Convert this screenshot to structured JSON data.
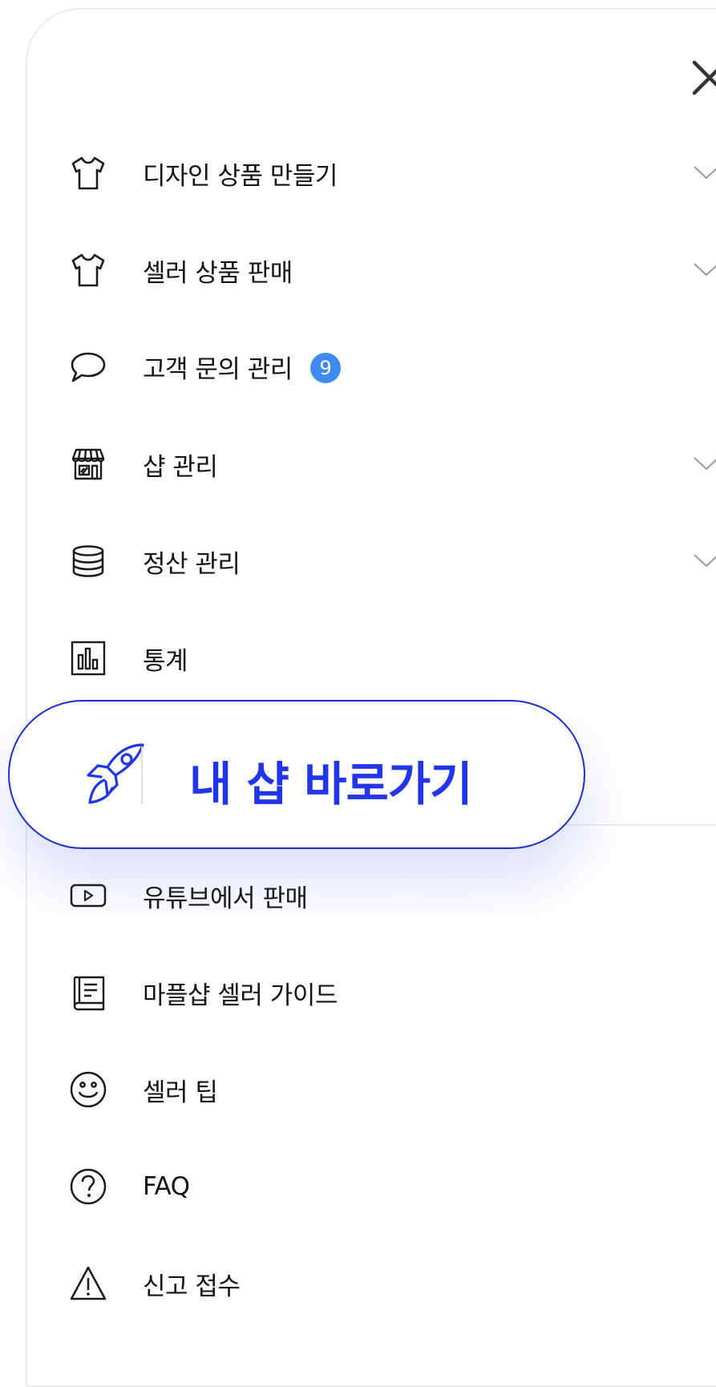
{
  "menu": {
    "primary": [
      {
        "label": "디자인 상품 만들기",
        "icon": "tshirt-icon",
        "expandable": true
      },
      {
        "label": "셀러 상품 판매",
        "icon": "tshirt-icon",
        "expandable": true
      },
      {
        "label": "고객 문의 관리",
        "icon": "chat-bubble-icon",
        "expandable": false,
        "badge": "9"
      },
      {
        "label": "샵 관리",
        "icon": "storefront-icon",
        "expandable": true
      },
      {
        "label": "정산 관리",
        "icon": "database-icon",
        "expandable": true
      },
      {
        "label": "통계",
        "icon": "bar-chart-icon",
        "expandable": false
      }
    ],
    "secondary": [
      {
        "label": "유튜브에서 판매",
        "icon": "play-icon"
      },
      {
        "label": "마플샵 셀러 가이드",
        "icon": "book-icon"
      },
      {
        "label": "셀러 팁",
        "icon": "smile-icon"
      },
      {
        "label": "FAQ",
        "icon": "help-icon"
      },
      {
        "label": "신고 접수",
        "icon": "warning-icon"
      }
    ]
  },
  "shortcut": {
    "label": "내 샵 바로가기",
    "icon": "rocket-icon"
  },
  "colors": {
    "accent": "#2036e8",
    "badge": "#3d8bf0",
    "text": "#141414",
    "icon": "#1a1a1a"
  }
}
